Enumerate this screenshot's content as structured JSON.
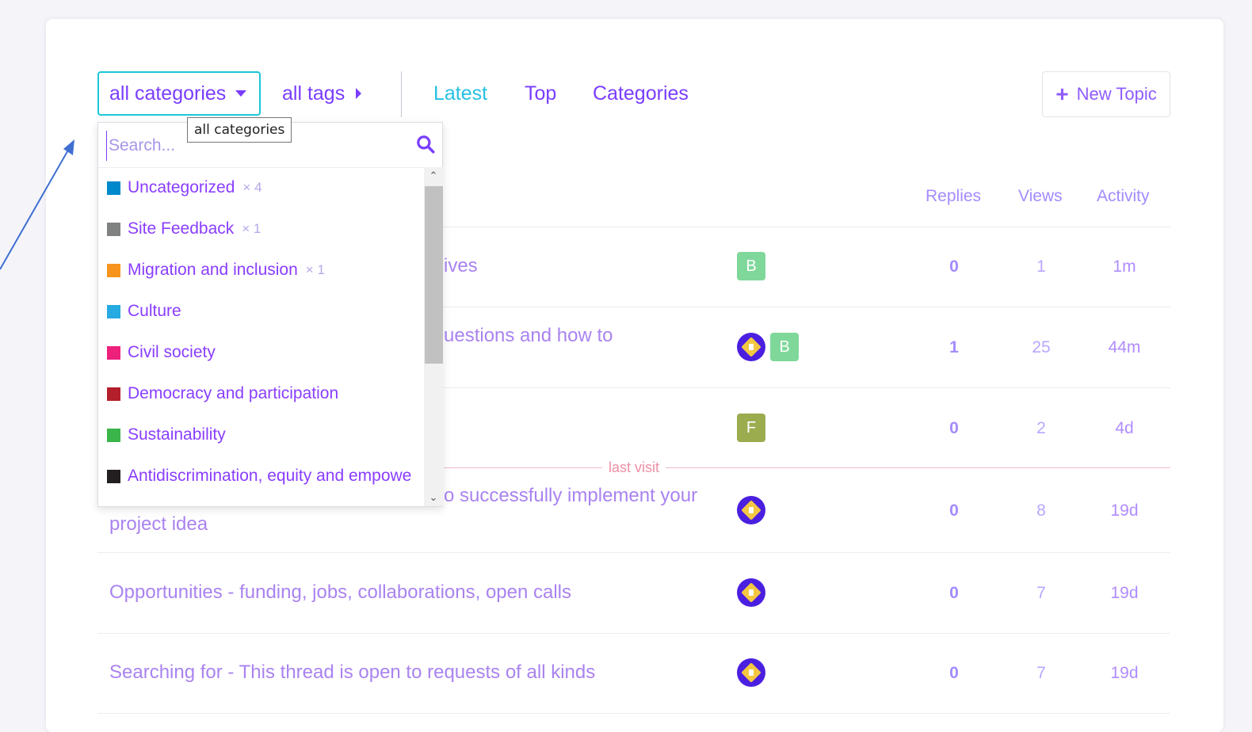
{
  "nav": {
    "category_dropdown": "all categories",
    "tag_dropdown": "all tags",
    "links": [
      "Latest",
      "Top",
      "Categories"
    ],
    "new_topic": "New Topic"
  },
  "tooltip": "all categories",
  "category_menu": {
    "search_placeholder": "Search...",
    "items": [
      {
        "name": "Uncategorized",
        "count": "× 4",
        "color": "#0088cc"
      },
      {
        "name": "Site Feedback",
        "count": "× 1",
        "color": "#808281"
      },
      {
        "name": "Migration and inclusion",
        "count": "× 1",
        "color": "#f7941d"
      },
      {
        "name": "Culture",
        "count": "",
        "color": "#25aae1"
      },
      {
        "name": "Civil society",
        "count": "",
        "color": "#ed207b"
      },
      {
        "name": "Democracy and participation",
        "count": "",
        "color": "#b3202b"
      },
      {
        "name": "Sustainability",
        "count": "",
        "color": "#3ab54a"
      },
      {
        "name": "Antidiscrimination, equity and empowe",
        "count": "",
        "color": "#231f20"
      }
    ]
  },
  "table": {
    "headers": {
      "replies": "Replies",
      "views": "Views",
      "activity": "Activity"
    },
    "last_visit": "last visit",
    "rows": [
      {
        "title": "ives",
        "replies": "0",
        "views": "1",
        "activity": "1m",
        "posters": [
          "B"
        ]
      },
      {
        "title": "uestions and how to",
        "replies": "1",
        "views": "25",
        "activity": "44m",
        "posters": [
          "logo",
          "B"
        ]
      },
      {
        "title": "",
        "replies": "0",
        "views": "2",
        "activity": "4d",
        "posters": [
          "F"
        ]
      },
      {
        "title_line1": "o successfully implement your",
        "title_line2": "project idea",
        "replies": "0",
        "views": "8",
        "activity": "19d",
        "posters": [
          "logo"
        ]
      },
      {
        "title": "Opportunities - funding, jobs, collaborations, open calls",
        "replies": "0",
        "views": "7",
        "activity": "19d",
        "posters": [
          "logo"
        ]
      },
      {
        "title": "Searching for - This thread is open to requests of all kinds",
        "replies": "0",
        "views": "7",
        "activity": "19d",
        "posters": [
          "logo"
        ]
      }
    ]
  },
  "avatar_colors": {
    "B": "#7fd89a",
    "F": "#9aac4e",
    "logo": "#4a1fe0"
  }
}
